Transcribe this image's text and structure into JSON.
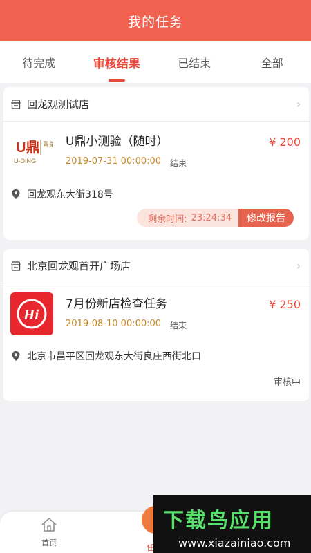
{
  "header": {
    "title": "我的任务"
  },
  "tabs": [
    {
      "label": "待完成"
    },
    {
      "label": "审核结果"
    },
    {
      "label": "已结束"
    },
    {
      "label": "全部"
    }
  ],
  "active_tab": "审核结果",
  "cards": [
    {
      "store_name": "回龙观测试店",
      "logo": {
        "brand_top": "U鼎",
        "brand_side": "冒菜",
        "brand_bottom": "U-DING"
      },
      "task_title": "U鼎小测验（随时）",
      "date": "2019-07-31 00:00:00",
      "status": "结束",
      "price": "¥ 200",
      "address": "回龙观东大街318号",
      "remaining_label": "剩余时间:",
      "remaining_time": "23:24:34",
      "action_label": "修改报告"
    },
    {
      "store_name": "北京回龙观首开广场店",
      "logo": {
        "brand": "Hi"
      },
      "task_title": "7月份新店检查任务",
      "date": "2019-08-10 00:00:00",
      "status": "结束",
      "price": "¥ 250",
      "address": "北京市昌平区回龙观东大街良庄西街北口",
      "review_status": "审核中"
    }
  ],
  "bottom_nav": {
    "home_label": "首页",
    "task_label": "任"
  },
  "watermark": {
    "title": "下载鸟应用",
    "url": "www.xiazainiao.com"
  },
  "icons": [
    "store-icon",
    "chevron-right-icon",
    "location-pin-icon",
    "home-icon",
    "task-icon"
  ],
  "colors": {
    "header": "#f0614f",
    "accent": "#e8493a",
    "date": "#c8892b",
    "timer_bg": "#fbe3de",
    "action_bg": "#e8634f",
    "background": "#f2f2f4"
  }
}
